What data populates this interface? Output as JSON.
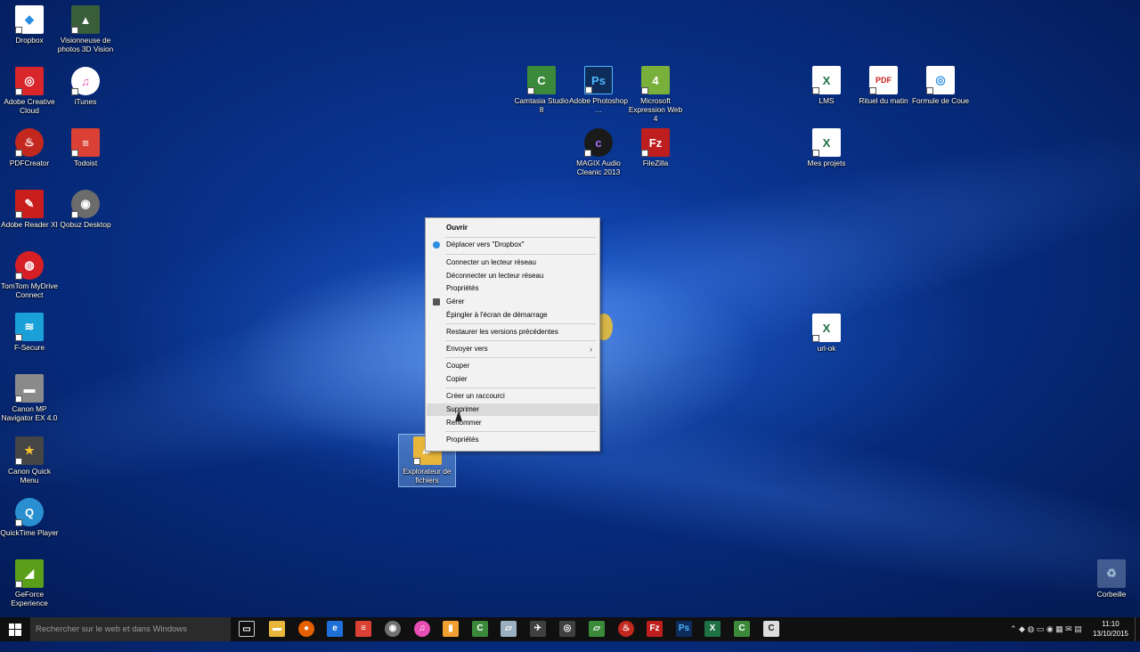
{
  "desktop": {
    "icons": [
      {
        "label": "Dropbox",
        "glyph": "◆",
        "color": "#2b8ee0"
      },
      {
        "label": "Visionneuse de photos 3D Vision",
        "glyph": "▲",
        "color": "#3a5e3a"
      },
      {
        "label": "Adobe Creative Cloud",
        "glyph": "◎",
        "color": "#d8262b"
      },
      {
        "label": "iTunes",
        "glyph": "♫",
        "color": "#e74db4"
      },
      {
        "label": "PDFCreator",
        "glyph": "♨",
        "color": "#c3281e"
      },
      {
        "label": "Todoist",
        "glyph": "≡",
        "color": "#db4035"
      },
      {
        "label": "Adobe Reader XI",
        "glyph": "✎",
        "color": "#c81e1e"
      },
      {
        "label": "Qobuz Desktop",
        "glyph": "◉",
        "color": "#6c6c6c"
      },
      {
        "label": "TomTom MyDrive Connect",
        "glyph": "◍",
        "color": "#d71f26"
      },
      {
        "label": "F-Secure",
        "glyph": "≋",
        "color": "#1aa0d8"
      },
      {
        "label": "Canon MP Navigator EX 4.0",
        "glyph": "▬",
        "color": "#8a8a8a"
      },
      {
        "label": "Canon Quick Menu",
        "glyph": "★",
        "color": "#454545"
      },
      {
        "label": "QuickTime Player",
        "glyph": "Q",
        "color": "#2a8fd0"
      },
      {
        "label": "GeForce Experience",
        "glyph": "◢",
        "color": "#5a9e1a"
      },
      {
        "label": "Camtasia Studio 8",
        "glyph": "C",
        "color": "#3b8a3b"
      },
      {
        "label": "Adobe Photoshop ...",
        "glyph": "Ps",
        "color": "#0d2c5a"
      },
      {
        "label": "Microsoft Expression Web 4",
        "glyph": "4",
        "color": "#79b03b"
      },
      {
        "label": "MAGIX Audio Cleanic 2013",
        "glyph": "c",
        "color": "#1a1a1a"
      },
      {
        "label": "FileZilla",
        "glyph": "Fz",
        "color": "#bf1e1e"
      },
      {
        "label": "LMS",
        "glyph": "X",
        "color": "#1e7145"
      },
      {
        "label": "Rituel du matin",
        "glyph": "PDF",
        "color": "#c81e1e"
      },
      {
        "label": "Formule de Coue",
        "glyph": "◎",
        "color": "#2a8ee0"
      },
      {
        "label": "Mes projets",
        "glyph": "X",
        "color": "#1e7145"
      },
      {
        "label": "url-ok",
        "glyph": "X",
        "color": "#1e7145"
      },
      {
        "label": "Explorateur de fichiers",
        "glyph": "▰",
        "color": "#e8b63a"
      },
      {
        "label": "Corbeille",
        "glyph": "♻",
        "color": "#9ab8d0"
      }
    ]
  },
  "context_menu": {
    "items": [
      {
        "label": "Ouvrir",
        "bold": true
      },
      {
        "label": "Déplacer vers \"Dropbox\"",
        "icon": "dropbox"
      },
      {
        "label": "Connecter un lecteur réseau"
      },
      {
        "label": "Déconnecter un lecteur réseau"
      },
      {
        "label": "Propriétés"
      },
      {
        "label": "Gérer",
        "icon": "shield"
      },
      {
        "label": "Épingler à l'écran de démarrage"
      },
      {
        "label": "Restaurer les versions précédentes"
      },
      {
        "label": "Envoyer vers",
        "arrow": "›"
      },
      {
        "label": "Couper"
      },
      {
        "label": "Copier"
      },
      {
        "label": "Créer un raccourci"
      },
      {
        "label": "Supprimer",
        "highlighted": true
      },
      {
        "label": "Renommer"
      },
      {
        "label": "Propriétés"
      }
    ]
  },
  "taskbar": {
    "search_placeholder": "Rechercher sur le web et dans Windows",
    "pinned": [
      {
        "glyph": "▭",
        "color": "#101010"
      },
      {
        "glyph": "▬",
        "color": "#e8b63a"
      },
      {
        "glyph": "●",
        "color": "#e66000"
      },
      {
        "glyph": "e",
        "color": "#1e6fd8"
      },
      {
        "glyph": "≡",
        "color": "#db4035"
      },
      {
        "glyph": "◉",
        "color": "#707070"
      },
      {
        "glyph": "♫",
        "color": "#e74db4"
      },
      {
        "glyph": "▮",
        "color": "#f0a030"
      },
      {
        "glyph": "C",
        "color": "#3b8a3b"
      },
      {
        "glyph": "▱",
        "color": "#9ab0c0"
      },
      {
        "glyph": "✈",
        "color": "#404040"
      },
      {
        "glyph": "♨",
        "color": "#c3281e"
      },
      {
        "glyph": "Fz",
        "color": "#bf1e1e"
      },
      {
        "glyph": "Ps",
        "color": "#0d2c5a"
      },
      {
        "glyph": "X",
        "color": "#1e7145"
      },
      {
        "glyph": "C",
        "color": "#3b8a3b"
      },
      {
        "glyph": "C",
        "color": "#dddddd"
      }
    ],
    "tray": "⌃ ◆ ◍ ▭ ◉ ▦ ✉ ▤",
    "time": "11:10",
    "date": "13/10/2015"
  }
}
